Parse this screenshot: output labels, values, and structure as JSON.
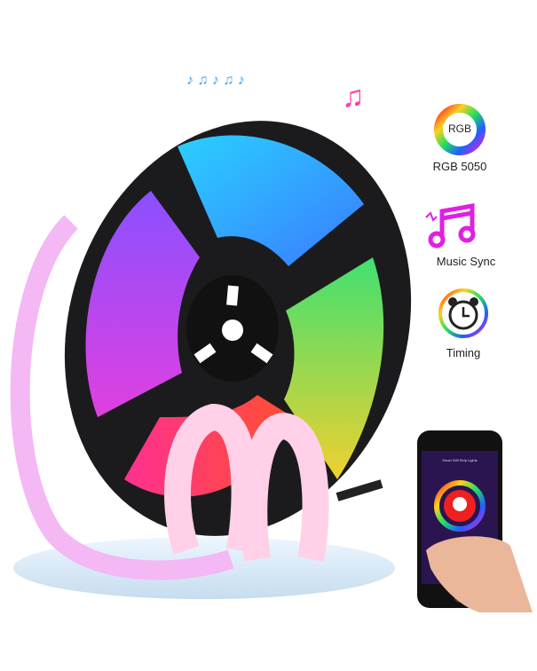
{
  "features": [
    {
      "label": "RGB 5050",
      "icon": "rgb-ring-icon",
      "icon_text": "RGB"
    },
    {
      "label": "Music Sync",
      "icon": "music-note-icon"
    },
    {
      "label": "Timing",
      "icon": "alarm-clock-icon"
    }
  ],
  "phone": {
    "app_title": "Smart Wifi Strip Lights"
  },
  "colors": {
    "blue": "#2fb7ff",
    "green": "#7be04a",
    "red": "#ff2a5a",
    "purple": "#b04cff",
    "magenta": "#e020e0",
    "reel": "#1b1b1d"
  }
}
